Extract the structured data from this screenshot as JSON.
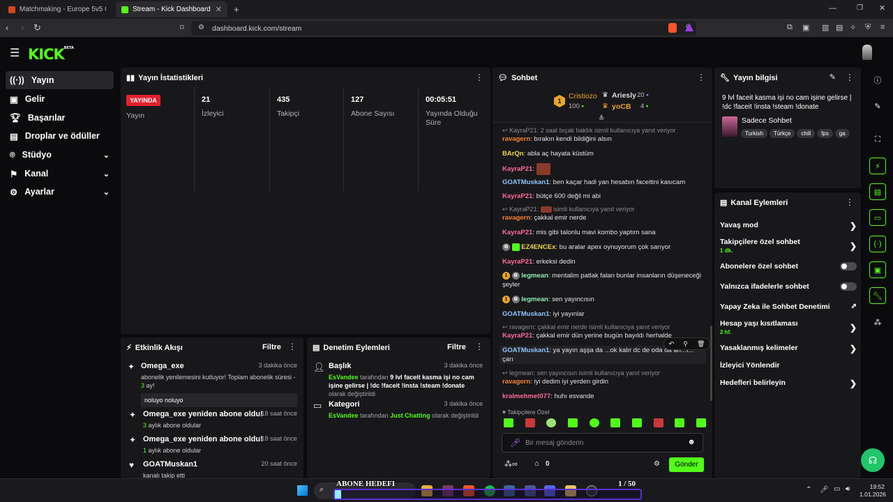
{
  "browser": {
    "tabs": [
      {
        "label": "Matchmaking - Europe 5v5 Queue - "
      },
      {
        "label": "Stream - Kick Dashboard"
      }
    ],
    "url": "dashboard.kick.com/stream"
  },
  "sidebar": {
    "logo": "KICK",
    "logo_beta": "BETA",
    "items": [
      {
        "label": "Yayın"
      },
      {
        "label": "Gelir"
      },
      {
        "label": "Başarılar"
      },
      {
        "label": "Droplar ve ödüller"
      },
      {
        "label": "Stüdyo"
      },
      {
        "label": "Kanal"
      },
      {
        "label": "Ayarlar"
      }
    ]
  },
  "stats": {
    "title": "Yayın İstatistikleri",
    "live_badge": "YAYINDA",
    "live_label": "Yayın",
    "viewers_value": "21",
    "viewers_label": "İzleyici",
    "followers_value": "435",
    "followers_label": "Takipçi",
    "subs_value": "127",
    "subs_label": "Abone Sayısı",
    "uptime_value": "00:05:51",
    "uptime_label": "Yayında Olduğu Süre"
  },
  "activity": {
    "title": "Etkinlik Akışı",
    "filter": "Filtre",
    "events": [
      {
        "name": "Omega_exe",
        "time": "3 dakika önce",
        "text_a": "abonelik yenilemesini kutluyor! Toplam abonelik süresi - ",
        "text_num": "3",
        "text_b": " ay!",
        "message": "noluyo noluyo"
      },
      {
        "name": "Omega_exe yeniden abone oldu!",
        "time": "18 saat önce",
        "num": "3",
        "text": " aylık abone oldular"
      },
      {
        "name": "Omega_exe yeniden abone oldu!",
        "time": "18 saat önce",
        "num": "1",
        "text": " aylık abone oldular"
      },
      {
        "name": "GOATMuskan1",
        "time": "20 saat önce",
        "text": "kanalı takip etti"
      }
    ]
  },
  "moderation": {
    "title": "Denetim Eylemleri",
    "filter": "Filtre",
    "items": [
      {
        "name": "Başlık",
        "time": "3 dakika önce",
        "user": "EsVandee",
        "mid": " tarafından ",
        "value": "9 lvl faceit kasma işi no cam işine gelirse | !dc !faceit !insta !steam !donate",
        "tail": " olarak değiştirildi"
      },
      {
        "name": "Kategori",
        "time": "3 dakika önce",
        "user": "EsVandee",
        "mid": " tarafından ",
        "value": "Just Chatting",
        "tail": " olarak değiştirildi"
      }
    ]
  },
  "chat": {
    "title": "Sohbet",
    "leaders": [
      {
        "name": "Cristiozo",
        "count": "100"
      },
      {
        "name": "Ariesly",
        "count": "20"
      },
      {
        "name": "yoCB",
        "count": "4"
      }
    ],
    "rank_badge": "1",
    "messages": [
      {
        "reply": "KayraP21: 2 saat bıçak baktık isimli kullanıcıya yanıt veriyor"
      },
      {
        "user": "ravagern",
        "text": "bırakın kendi bildiğini alsın"
      },
      {
        "user": "BArQn",
        "text": "abla aç hayata küstüm"
      },
      {
        "user": "KayraP21",
        "text": ""
      },
      {
        "user": "GOATMuskan1",
        "text": "ben kaçar hadi yan hesabın faceitini kasıcam"
      },
      {
        "user": "KayraP21",
        "text": "bütçe 600 değil mi abi"
      },
      {
        "reply": "KayraP21: ",
        "reply_tail": " isimli kullanıcıya yanıt veriyor"
      },
      {
        "user": "ravagern",
        "text": "çakkal emir nerde"
      },
      {
        "user": "KayraP21",
        "text": "mis gibi talonlu mavi kombo yaptım sana"
      },
      {
        "user": "EZ4ENCEx",
        "text": "bu aralar apex oynuyorum çok sarıyor"
      },
      {
        "user": "KayraP21",
        "text": "erkeksi dedin"
      },
      {
        "user": "legmean",
        "text": "mentalim patlak falan bunlar insanların düşeneceği şeyler"
      },
      {
        "user": "legmean",
        "text": "sen yayıncısın"
      },
      {
        "user": "GOATMuskan1",
        "text": "iyi yayınlar"
      },
      {
        "reply": "ravagern: çakkal emir nerde isimli kullanıcıya yanıt veriyor"
      },
      {
        "user": "KayraP21",
        "text": "çakkal emir dün yerine bugün bayıldı herhalde"
      },
      {
        "user": "GOATMuskan1",
        "text": "ya yayın aşşa da ...ok kalır dc de oda da an...ı... çarı"
      },
      {
        "reply": "legmean: sen yayıncısın isimli kullanıcıya yanıt veriyor"
      },
      {
        "user": "ravagern",
        "text": "iyi dedim iyi yerden girdin"
      },
      {
        "user": "kralmehmet077",
        "text": "huhı esvande"
      }
    ],
    "followers_only": "Takipçilere Özel",
    "input_placeholder": "Bir mesaj gönderin",
    "points": "0",
    "send": "Gönder"
  },
  "stream_info": {
    "title": "Yayın bilgisi",
    "stream_title": "9 lvl faceit kasma işi no cam işine gelirse | !dc !faceit !insta !steam !donate",
    "category": "Sadece Sohbet",
    "tags": [
      "Turkish",
      "Türkçe",
      "chill",
      "fps",
      "ga"
    ]
  },
  "channel_actions": {
    "title": "Kanal Eylemleri",
    "items": [
      {
        "label": "Yavaş mod"
      },
      {
        "label": "Takipçilere özel sohbet",
        "sub": "1 dk."
      },
      {
        "label": "Abonelere özel sohbet"
      },
      {
        "label": "Yalnızca ifadelerle sohbet"
      },
      {
        "label": "Yapay Zeka ile Sohbet Denetimi"
      },
      {
        "label": "Hesap yaşı kısıtlaması",
        "sub": "2 hf."
      },
      {
        "label": "Yasaklanmış kelimeler"
      },
      {
        "label": "İzleyici Yönlendir"
      },
      {
        "label": "Hedefleri belirleyin"
      }
    ]
  },
  "overlay": {
    "goal_label": "ABONE HEDEFI",
    "goal_progress": "1 / 50"
  },
  "taskbar": {
    "time": "19:52",
    "date": "1.01.2026"
  },
  "colors": {
    "accent": "#53fc18",
    "live": "#e5202b",
    "panel": "#18181b"
  }
}
